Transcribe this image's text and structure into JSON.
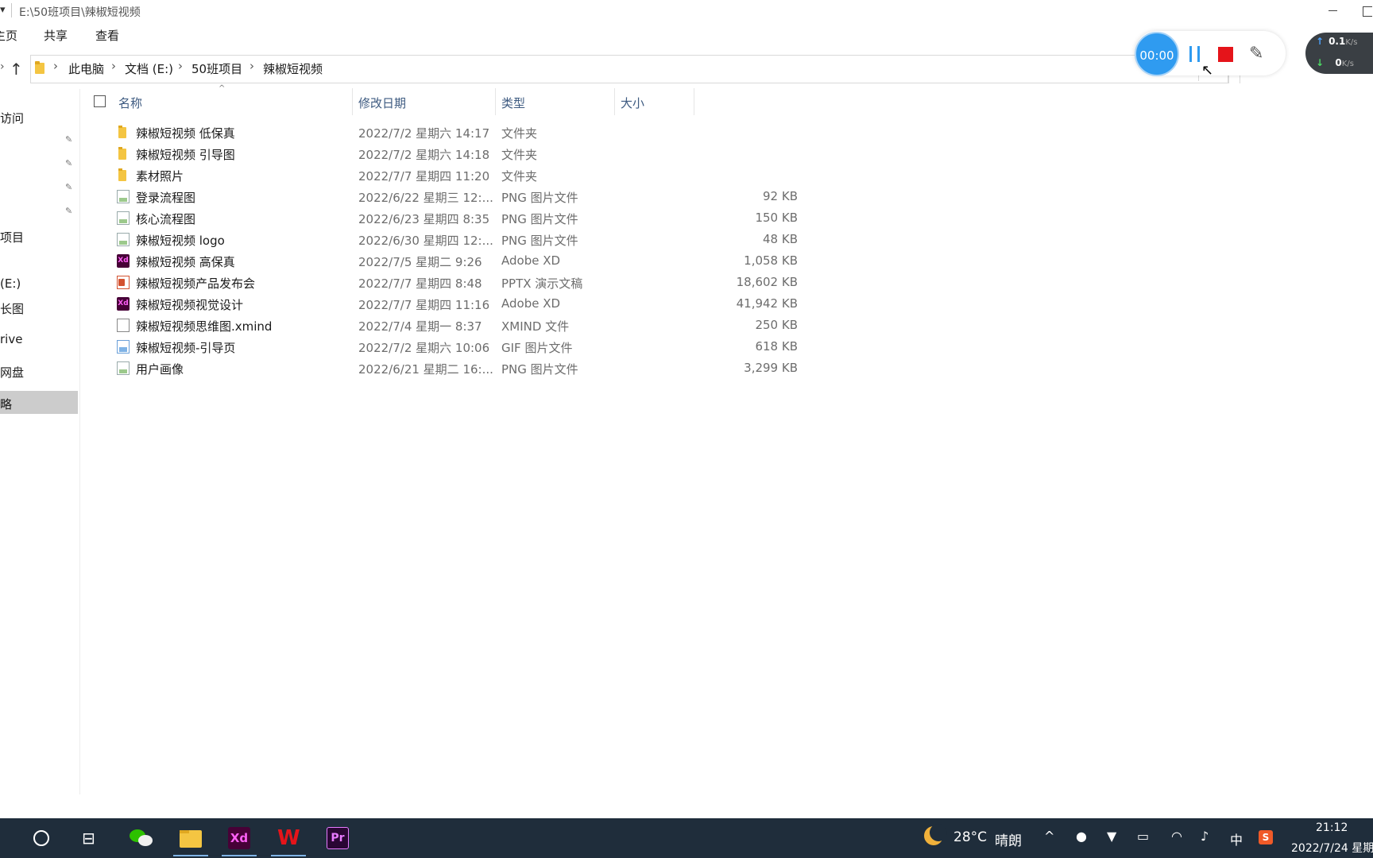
{
  "window": {
    "title_path": "E:\\50班项目\\辣椒短视频"
  },
  "menu": {
    "home": "主页",
    "share": "共享",
    "view": "查看"
  },
  "address": {
    "crumbs": [
      "此电脑",
      "文档 (E:)",
      "50班项目",
      "辣椒短视频"
    ]
  },
  "nav": {
    "items": [
      "访问",
      "项目",
      "(E:)",
      "长图",
      "rive",
      "网盘",
      "略"
    ]
  },
  "columns": {
    "name": "名称",
    "date": "修改日期",
    "type": "类型",
    "size": "大小"
  },
  "files": [
    {
      "icon": "folder-icon",
      "name": "辣椒短视频 低保真",
      "date": "2022/7/2 星期六 14:17",
      "type": "文件夹",
      "size": ""
    },
    {
      "icon": "folder-icon",
      "name": "辣椒短视频 引导图",
      "date": "2022/7/2 星期六 14:18",
      "type": "文件夹",
      "size": ""
    },
    {
      "icon": "folder-icon",
      "name": "素材照片",
      "date": "2022/7/7 星期四 11:20",
      "type": "文件夹",
      "size": ""
    },
    {
      "icon": "png-file-icon",
      "name": "登录流程图",
      "date": "2022/6/22 星期三 12:...",
      "type": "PNG 图片文件",
      "size": "92 KB"
    },
    {
      "icon": "png-file-icon",
      "name": "核心流程图",
      "date": "2022/6/23 星期四 8:35",
      "type": "PNG 图片文件",
      "size": "150 KB"
    },
    {
      "icon": "png-file-icon",
      "name": "辣椒短视频 logo",
      "date": "2022/6/30 星期四 12:...",
      "type": "PNG 图片文件",
      "size": "48 KB"
    },
    {
      "icon": "xd-file-icon",
      "name": "辣椒短视频 高保真",
      "date": "2022/7/5 星期二 9:26",
      "type": "Adobe XD",
      "size": "1,058 KB"
    },
    {
      "icon": "pptx-file-icon",
      "name": "辣椒短视频产品发布会",
      "date": "2022/7/7 星期四 8:48",
      "type": "PPTX 演示文稿",
      "size": "18,602 KB"
    },
    {
      "icon": "xd-file-icon",
      "name": "辣椒短视频视觉设计",
      "date": "2022/7/7 星期四 11:16",
      "type": "Adobe XD",
      "size": "41,942 KB"
    },
    {
      "icon": "generic-file-icon",
      "name": "辣椒短视频思维图.xmind",
      "date": "2022/7/4 星期一 8:37",
      "type": "XMIND 文件",
      "size": "250 KB"
    },
    {
      "icon": "gif-file-icon",
      "name": "辣椒短视频-引导页",
      "date": "2022/7/2 星期六 10:06",
      "type": "GIF 图片文件",
      "size": "618 KB"
    },
    {
      "icon": "png-file-icon",
      "name": "用户画像",
      "date": "2022/6/21 星期二 16:...",
      "type": "PNG 图片文件",
      "size": "3,299 KB"
    }
  ],
  "recorder": {
    "timer": "00:00"
  },
  "network": {
    "up_value": "0.1",
    "down_value": "0",
    "unit": "K/s"
  },
  "taskbar": {
    "weather_temp": "28°C",
    "weather_desc": "晴朗",
    "ime": "中",
    "sogou": "S",
    "xd_label": "Xd",
    "pr_label": "Pr",
    "wps_label": "W",
    "time": "21:12",
    "date": "2022/7/24 星期"
  }
}
